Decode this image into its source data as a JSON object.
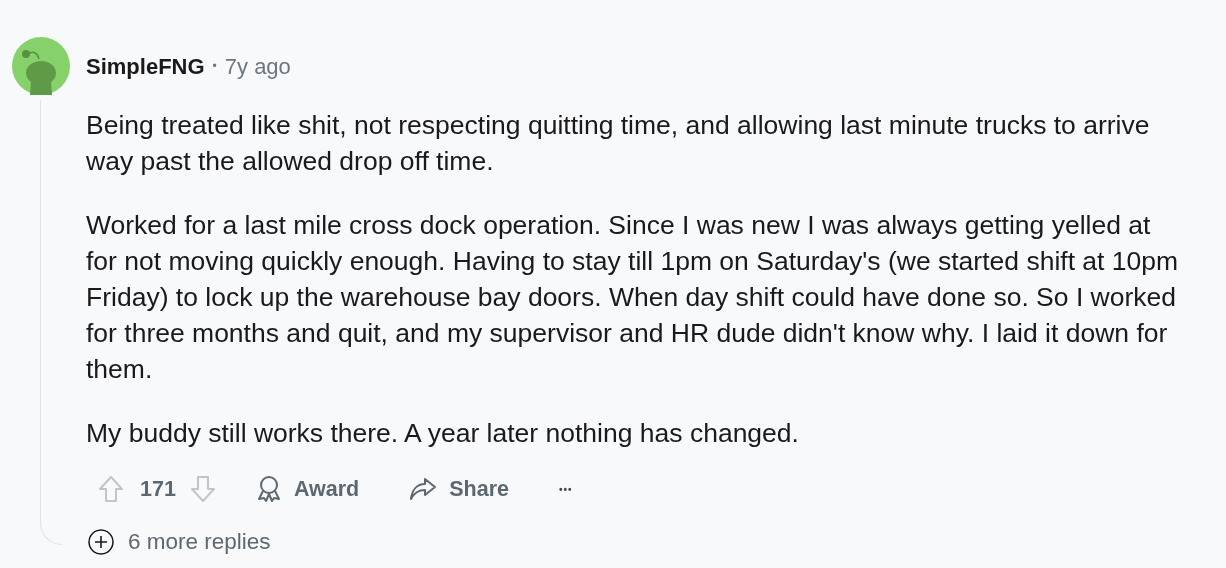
{
  "comment": {
    "author": "SimpleFNG",
    "separator": "•",
    "time": "7y ago",
    "paragraphs": [
      "Being treated like shit, not respecting quitting time, and allowing last minute trucks to arrive way past the allowed drop off time.",
      "Worked for a last mile cross dock operation. Since I was new I was always getting yelled at for not moving quickly enough. Having to stay till 1pm on Saturday's (we started shift at 10pm Friday) to lock up the warehouse bay doors. When day shift could have done so. So I worked for three months and quit, and my supervisor and HR dude didn't know why. I laid it down for them.",
      "My buddy still works there. A year later nothing has changed."
    ],
    "score": "171",
    "award_label": "Award",
    "share_label": "Share",
    "more_label": "•••",
    "replies_label": "6 more replies"
  }
}
